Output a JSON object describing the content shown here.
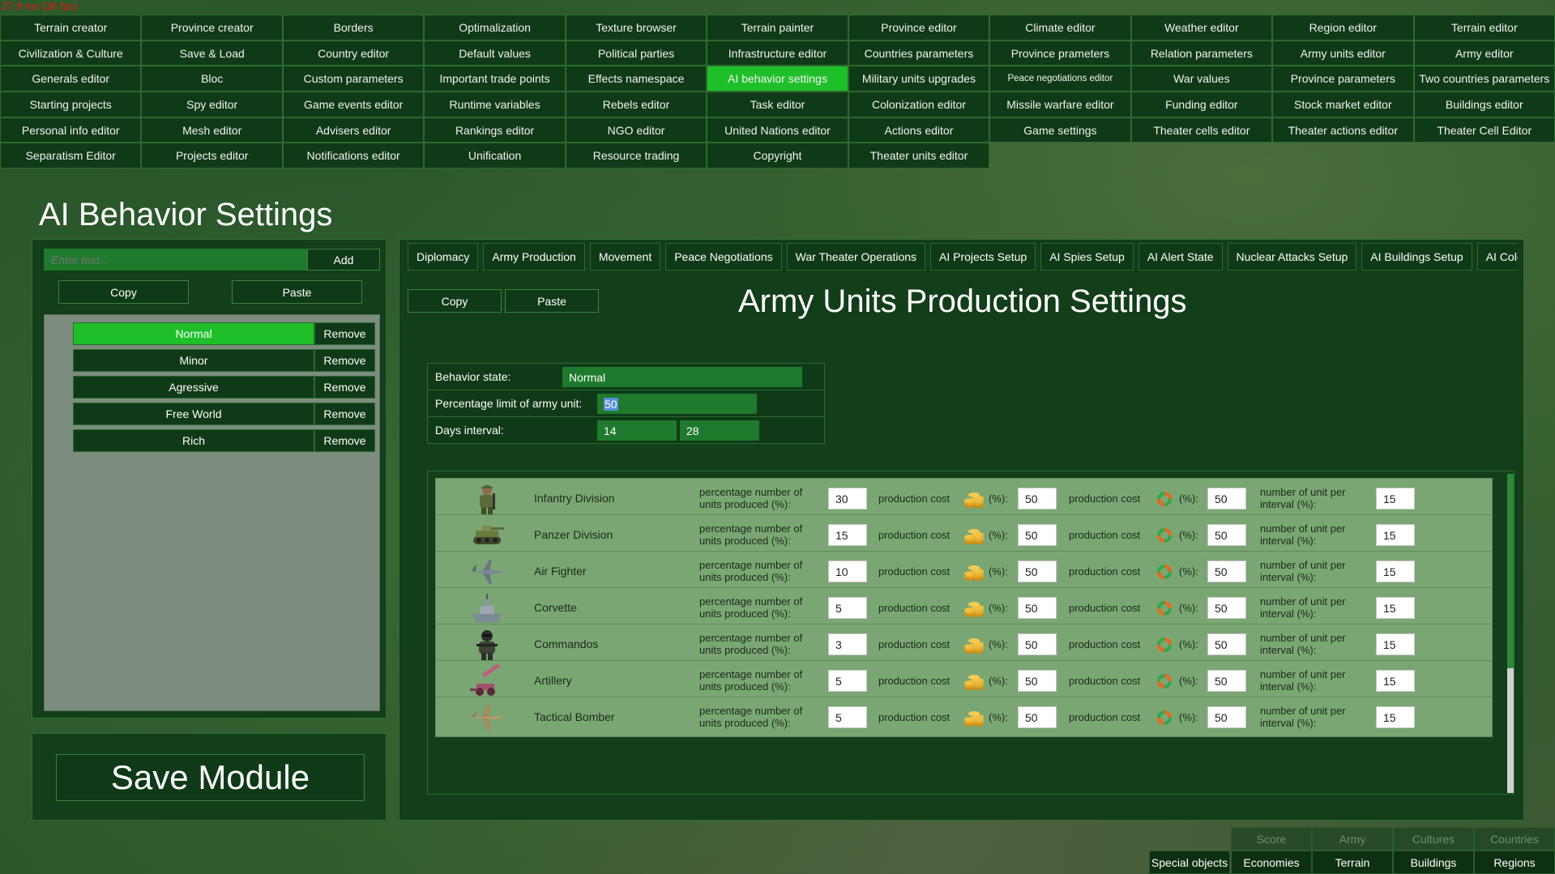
{
  "fps": "27.9 ms (36 fps)",
  "topnav": [
    [
      "Terrain creator",
      "Province creator",
      "Borders",
      "Optimalization",
      "Texture browser",
      "Terrain painter",
      "Province editor",
      "Climate editor",
      "Weather editor",
      "Region editor",
      "Terrain editor"
    ],
    [
      "Civilization & Culture",
      "Save & Load",
      "Country editor",
      "Default values",
      "Political parties",
      "Infrastructure editor",
      "Countries parameters",
      "Province prameters",
      "Relation parameters",
      "Army units editor",
      "Army editor"
    ],
    [
      "Generals editor",
      "Bloc",
      "Custom parameters",
      "Important trade points",
      "Effects namespace",
      "AI behavior settings",
      "Military units upgrades",
      "Peace negotiations editor",
      "War values",
      "Province parameters",
      "Two countries parameters"
    ],
    [
      "Starting projects",
      "Spy editor",
      "Game events editor",
      "Runtime variables",
      "Rebels editor",
      "Task editor",
      "Colonization editor",
      "Missile warfare editor",
      "Funding editor",
      "Stock market editor",
      "Buildings editor"
    ],
    [
      "Personal info editor",
      "Mesh editor",
      "Advisers editor",
      "Rankings editor",
      "NGO editor",
      "United Nations editor",
      "Actions editor",
      "Game settings",
      "Theater cells editor",
      "Theater actions editor",
      "Theater Cell Editor"
    ],
    [
      "Separatism Editor",
      "Projects editor",
      "Notifications editor",
      "Unification",
      "Resource trading",
      "Copyright",
      "Theater units editor"
    ]
  ],
  "page_title": "AI Behavior Settings",
  "left": {
    "input_placeholder": "Enter text...",
    "add": "Add",
    "copy": "Copy",
    "paste": "Paste",
    "remove": "Remove",
    "items": [
      "Normal",
      "Minor",
      "Agressive",
      "Free World",
      "Rich"
    ],
    "selected": "Normal"
  },
  "save_module": "Save Module",
  "tabs": [
    "Diplomacy",
    "Army Production",
    "Movement",
    "Peace Negotiations",
    "War Theater Operations",
    "AI Projects Setup",
    "AI Spies Setup",
    "AI Alert State",
    "Nuclear Attacks Setup",
    "AI Buildings Setup",
    "AI Coloniz"
  ],
  "section": {
    "copy": "Copy",
    "paste": "Paste",
    "title": "Army Units Production Settings"
  },
  "behavior": {
    "state_label": "Behavior state:",
    "state_value": "Normal",
    "limit_label": "Percentage limit of army unit:",
    "limit_value": "50",
    "days_label": "Days interval:",
    "days_min": "14",
    "days_max": "28"
  },
  "col_labels": {
    "pct_line1": "percentage number of",
    "pct_line2": "units produced (%):",
    "prod_cost": "production cost",
    "pct": "(%):",
    "num_line1": "number of unit per",
    "num_line2": "interval (%):"
  },
  "units": [
    {
      "name": "Infantry Division",
      "icon": "infantry-icon",
      "pct": "30",
      "gold": "50",
      "cycle": "50",
      "per_interval": "15"
    },
    {
      "name": "Panzer Division",
      "icon": "tank-icon",
      "pct": "15",
      "gold": "50",
      "cycle": "50",
      "per_interval": "15"
    },
    {
      "name": "Air Fighter",
      "icon": "fighter-jet-icon",
      "pct": "10",
      "gold": "50",
      "cycle": "50",
      "per_interval": "15"
    },
    {
      "name": "Corvette",
      "icon": "ship-icon",
      "pct": "5",
      "gold": "50",
      "cycle": "50",
      "per_interval": "15"
    },
    {
      "name": "Commandos",
      "icon": "commando-icon",
      "pct": "3",
      "gold": "50",
      "cycle": "50",
      "per_interval": "15"
    },
    {
      "name": "Artillery",
      "icon": "artillery-icon",
      "pct": "5",
      "gold": "50",
      "cycle": "50",
      "per_interval": "15"
    },
    {
      "name": "Tactical Bomber",
      "icon": "bomber-icon",
      "pct": "5",
      "gold": "50",
      "cycle": "50",
      "per_interval": "15"
    }
  ],
  "bottom_bar": {
    "row1": [
      "Score",
      "Army",
      "Cultures",
      "Countries"
    ],
    "row2": [
      "Special objects",
      "Economies",
      "Terrain",
      "Buildings",
      "Regions"
    ]
  },
  "colors": {
    "panel": "#0f3a17",
    "active": "#1fbf2a",
    "unit_row": "#7aa674",
    "fps": "#e01818"
  }
}
